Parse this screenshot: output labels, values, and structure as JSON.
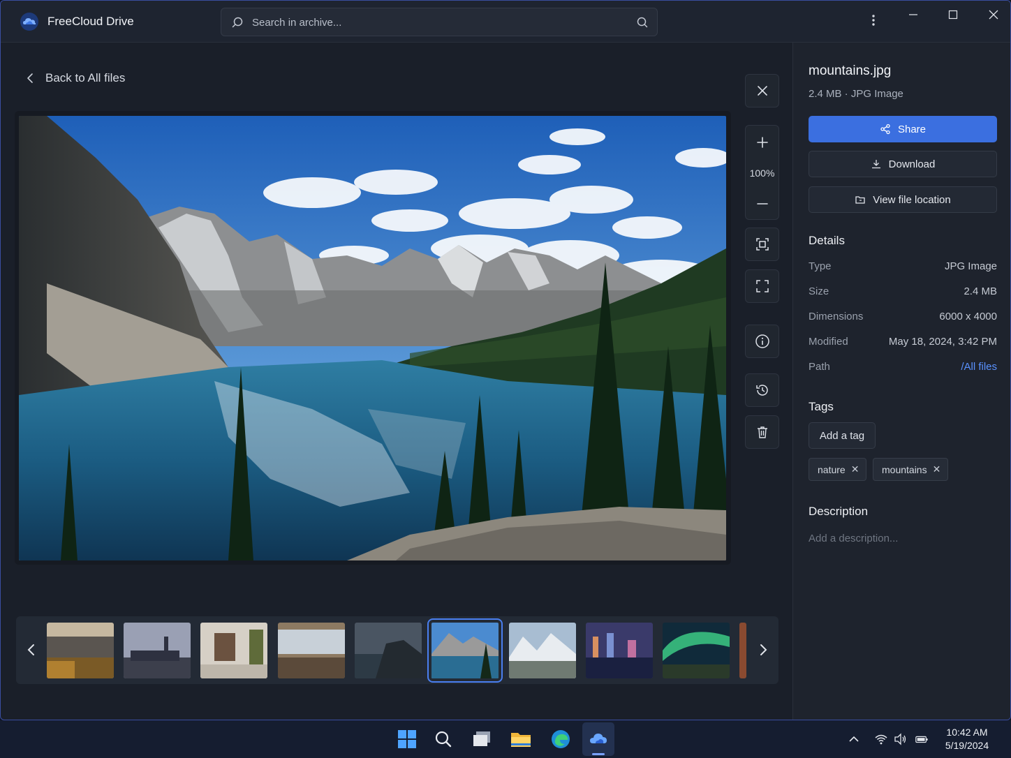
{
  "app": {
    "title": "FreeCloud Drive",
    "logo_icon": "cloud-logo-icon"
  },
  "search": {
    "placeholder": "Search in archive..."
  },
  "viewer": {
    "back_label": "Back to All files",
    "zoom_level": "100%",
    "image_subject": "mountain lake landscape"
  },
  "toolbar": {
    "close_icon": "close-icon",
    "zoom_in_icon": "plus-icon",
    "zoom_out_icon": "minus-icon",
    "fit_icon": "fit-to-screen-icon",
    "fullscreen_icon": "fullscreen-icon",
    "info_icon": "info-icon",
    "history_icon": "history-icon",
    "delete_icon": "trash-icon"
  },
  "filmstrip": {
    "thumbnails": [
      {
        "name": "autumn-lake"
      },
      {
        "name": "city-skyline"
      },
      {
        "name": "interior-room"
      },
      {
        "name": "modern-interior"
      },
      {
        "name": "coastal-rocks"
      },
      {
        "name": "mountains",
        "selected": true
      },
      {
        "name": "snowy-peaks"
      },
      {
        "name": "city-night"
      },
      {
        "name": "aurora"
      }
    ]
  },
  "details_panel": {
    "file_name": "mountains.jpg",
    "file_meta": "2.4 MB · JPG Image",
    "share_label": "Share",
    "download_label": "Download",
    "location_label": "View file location",
    "details_title": "Details",
    "rows": [
      {
        "key": "Type",
        "value": "JPG Image"
      },
      {
        "key": "Size",
        "value": "2.4 MB"
      },
      {
        "key": "Dimensions",
        "value": "6000 x 4000"
      },
      {
        "key": "Modified",
        "value": "May 18, 2024, 3:42 PM"
      },
      {
        "key": "Path",
        "value": "/All files"
      }
    ],
    "tags_title": "Tags",
    "add_tag_label": "Add a tag",
    "tags": [
      "nature",
      "mountains"
    ],
    "description_title": "Description",
    "description_placeholder": "Add a description..."
  },
  "taskbar": {
    "time": "10:42 AM",
    "date": "5/19/2024"
  },
  "colors": {
    "accent": "#3b6fe0",
    "link": "#5a92ff",
    "selected_outline": "#4a7ff0"
  }
}
